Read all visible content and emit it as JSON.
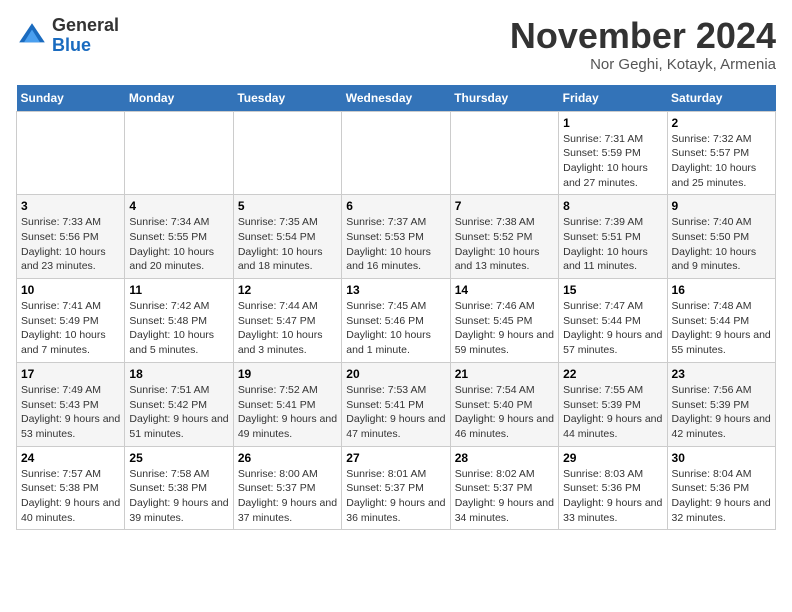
{
  "header": {
    "logo": {
      "line1": "General",
      "line2": "Blue"
    },
    "title": "November 2024",
    "location": "Nor Geghi, Kotayk, Armenia"
  },
  "calendar": {
    "days_of_week": [
      "Sunday",
      "Monday",
      "Tuesday",
      "Wednesday",
      "Thursday",
      "Friday",
      "Saturday"
    ],
    "weeks": [
      [
        {
          "day": "",
          "info": ""
        },
        {
          "day": "",
          "info": ""
        },
        {
          "day": "",
          "info": ""
        },
        {
          "day": "",
          "info": ""
        },
        {
          "day": "",
          "info": ""
        },
        {
          "day": "1",
          "info": "Sunrise: 7:31 AM\nSunset: 5:59 PM\nDaylight: 10 hours and 27 minutes."
        },
        {
          "day": "2",
          "info": "Sunrise: 7:32 AM\nSunset: 5:57 PM\nDaylight: 10 hours and 25 minutes."
        }
      ],
      [
        {
          "day": "3",
          "info": "Sunrise: 7:33 AM\nSunset: 5:56 PM\nDaylight: 10 hours and 23 minutes."
        },
        {
          "day": "4",
          "info": "Sunrise: 7:34 AM\nSunset: 5:55 PM\nDaylight: 10 hours and 20 minutes."
        },
        {
          "day": "5",
          "info": "Sunrise: 7:35 AM\nSunset: 5:54 PM\nDaylight: 10 hours and 18 minutes."
        },
        {
          "day": "6",
          "info": "Sunrise: 7:37 AM\nSunset: 5:53 PM\nDaylight: 10 hours and 16 minutes."
        },
        {
          "day": "7",
          "info": "Sunrise: 7:38 AM\nSunset: 5:52 PM\nDaylight: 10 hours and 13 minutes."
        },
        {
          "day": "8",
          "info": "Sunrise: 7:39 AM\nSunset: 5:51 PM\nDaylight: 10 hours and 11 minutes."
        },
        {
          "day": "9",
          "info": "Sunrise: 7:40 AM\nSunset: 5:50 PM\nDaylight: 10 hours and 9 minutes."
        }
      ],
      [
        {
          "day": "10",
          "info": "Sunrise: 7:41 AM\nSunset: 5:49 PM\nDaylight: 10 hours and 7 minutes."
        },
        {
          "day": "11",
          "info": "Sunrise: 7:42 AM\nSunset: 5:48 PM\nDaylight: 10 hours and 5 minutes."
        },
        {
          "day": "12",
          "info": "Sunrise: 7:44 AM\nSunset: 5:47 PM\nDaylight: 10 hours and 3 minutes."
        },
        {
          "day": "13",
          "info": "Sunrise: 7:45 AM\nSunset: 5:46 PM\nDaylight: 10 hours and 1 minute."
        },
        {
          "day": "14",
          "info": "Sunrise: 7:46 AM\nSunset: 5:45 PM\nDaylight: 9 hours and 59 minutes."
        },
        {
          "day": "15",
          "info": "Sunrise: 7:47 AM\nSunset: 5:44 PM\nDaylight: 9 hours and 57 minutes."
        },
        {
          "day": "16",
          "info": "Sunrise: 7:48 AM\nSunset: 5:44 PM\nDaylight: 9 hours and 55 minutes."
        }
      ],
      [
        {
          "day": "17",
          "info": "Sunrise: 7:49 AM\nSunset: 5:43 PM\nDaylight: 9 hours and 53 minutes."
        },
        {
          "day": "18",
          "info": "Sunrise: 7:51 AM\nSunset: 5:42 PM\nDaylight: 9 hours and 51 minutes."
        },
        {
          "day": "19",
          "info": "Sunrise: 7:52 AM\nSunset: 5:41 PM\nDaylight: 9 hours and 49 minutes."
        },
        {
          "day": "20",
          "info": "Sunrise: 7:53 AM\nSunset: 5:41 PM\nDaylight: 9 hours and 47 minutes."
        },
        {
          "day": "21",
          "info": "Sunrise: 7:54 AM\nSunset: 5:40 PM\nDaylight: 9 hours and 46 minutes."
        },
        {
          "day": "22",
          "info": "Sunrise: 7:55 AM\nSunset: 5:39 PM\nDaylight: 9 hours and 44 minutes."
        },
        {
          "day": "23",
          "info": "Sunrise: 7:56 AM\nSunset: 5:39 PM\nDaylight: 9 hours and 42 minutes."
        }
      ],
      [
        {
          "day": "24",
          "info": "Sunrise: 7:57 AM\nSunset: 5:38 PM\nDaylight: 9 hours and 40 minutes."
        },
        {
          "day": "25",
          "info": "Sunrise: 7:58 AM\nSunset: 5:38 PM\nDaylight: 9 hours and 39 minutes."
        },
        {
          "day": "26",
          "info": "Sunrise: 8:00 AM\nSunset: 5:37 PM\nDaylight: 9 hours and 37 minutes."
        },
        {
          "day": "27",
          "info": "Sunrise: 8:01 AM\nSunset: 5:37 PM\nDaylight: 9 hours and 36 minutes."
        },
        {
          "day": "28",
          "info": "Sunrise: 8:02 AM\nSunset: 5:37 PM\nDaylight: 9 hours and 34 minutes."
        },
        {
          "day": "29",
          "info": "Sunrise: 8:03 AM\nSunset: 5:36 PM\nDaylight: 9 hours and 33 minutes."
        },
        {
          "day": "30",
          "info": "Sunrise: 8:04 AM\nSunset: 5:36 PM\nDaylight: 9 hours and 32 minutes."
        }
      ]
    ]
  }
}
